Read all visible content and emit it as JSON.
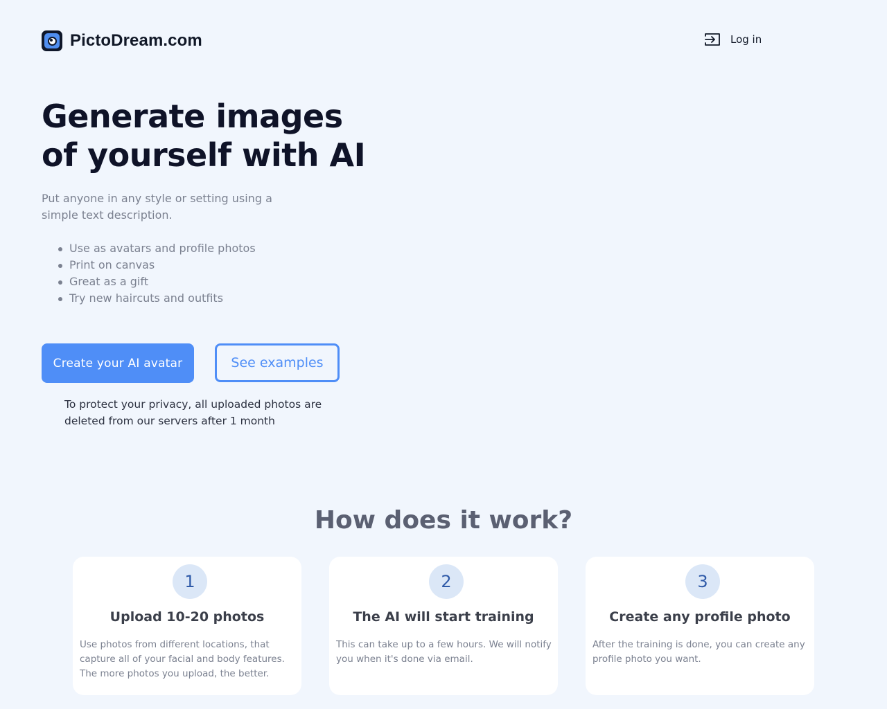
{
  "header": {
    "brand": "PictoDream.com",
    "logo_icon": "camera-lens-logo",
    "login_icon": "login-arrow-icon",
    "login_label": "Log in"
  },
  "hero": {
    "title_line1": "Generate images",
    "title_line2": "of yourself with AI",
    "subtitle": "Put anyone in any style or setting using a simple text description.",
    "features": [
      "Use as avatars and profile photos",
      "Print on canvas",
      "Great as a gift",
      "Try new haircuts and outfits"
    ],
    "primary_cta": "Create your AI avatar",
    "secondary_cta": "See examples",
    "privacy_note": "To protect your privacy, all uploaded photos are deleted from our servers after 1 month"
  },
  "how": {
    "title": "How does it work?",
    "steps": [
      {
        "number": "1",
        "title": "Upload 10-20 photos",
        "description": "Use photos from different locations, that capture all of your facial and body features. The more photos you upload, the better."
      },
      {
        "number": "2",
        "title": "The AI will start training",
        "description": "This can take up to a few hours. We will notify you when it's done via email."
      },
      {
        "number": "3",
        "title": "Create any profile photo",
        "description": "After the training is done, you can create any profile photo you want."
      }
    ]
  },
  "colors": {
    "background": "#f1f6fd",
    "accent": "#4f8ef7",
    "heading": "#0f1328",
    "muted": "#7b8190"
  }
}
